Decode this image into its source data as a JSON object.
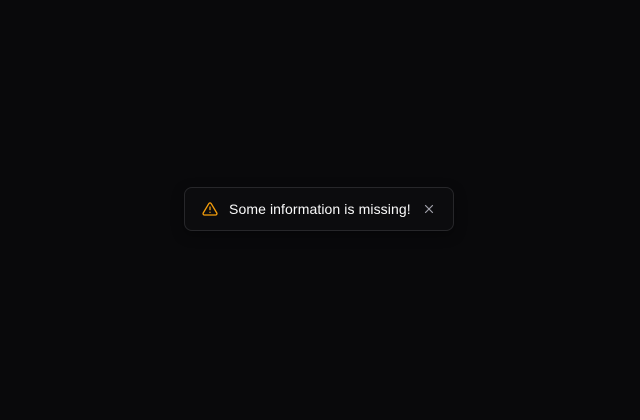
{
  "toast": {
    "message": "Some information is missing!",
    "icon": "warning-triangle-icon",
    "close_icon": "close-icon",
    "accent_color": "#f59e0b",
    "text_color": "#fafafa",
    "close_color": "#a1a1aa",
    "background_color": "#09090b"
  }
}
